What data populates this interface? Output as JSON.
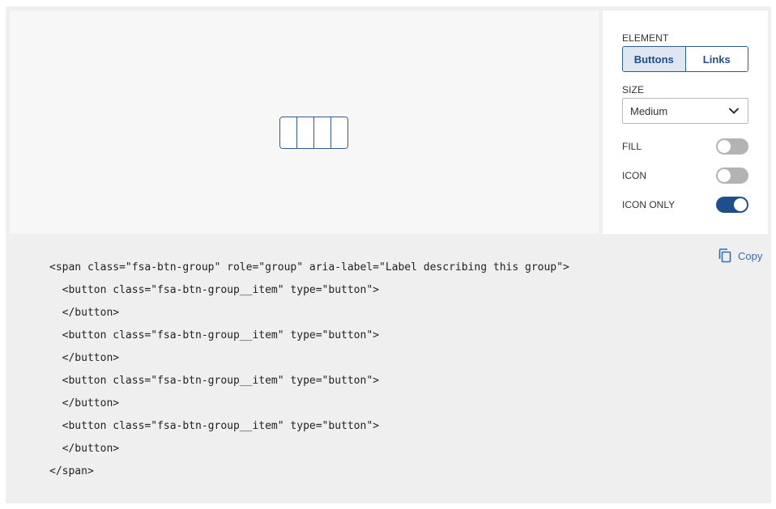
{
  "preview": {
    "button_group_items": 4
  },
  "controls": {
    "element": {
      "label": "ELEMENT",
      "options": [
        "Buttons",
        "Links"
      ],
      "selected": "Buttons"
    },
    "size": {
      "label": "SIZE",
      "value": "Medium"
    },
    "toggles": [
      {
        "label": "FILL",
        "on": false
      },
      {
        "label": "ICON",
        "on": false
      },
      {
        "label": "ICON ONLY",
        "on": true
      }
    ]
  },
  "copy_label": "Copy",
  "code_lines": [
    "<span class=\"fsa-btn-group\" role=\"group\" aria-label=\"Label describing this group\">",
    "  <button class=\"fsa-btn-group__item\" type=\"button\">",
    "  </button>",
    "  <button class=\"fsa-btn-group__item\" type=\"button\">",
    "  </button>",
    "  <button class=\"fsa-btn-group__item\" type=\"button\">",
    "  </button>",
    "  <button class=\"fsa-btn-group__item\" type=\"button\">",
    "  </button>",
    "</span>"
  ],
  "colors": {
    "accent": "#1f4f8a",
    "link": "#2f6fb6",
    "panel_bg": "#efefef",
    "preview_bg": "#f7f7f7"
  },
  "icons": {
    "copy": "copy-icon",
    "chevron": "chevron-down-icon"
  }
}
